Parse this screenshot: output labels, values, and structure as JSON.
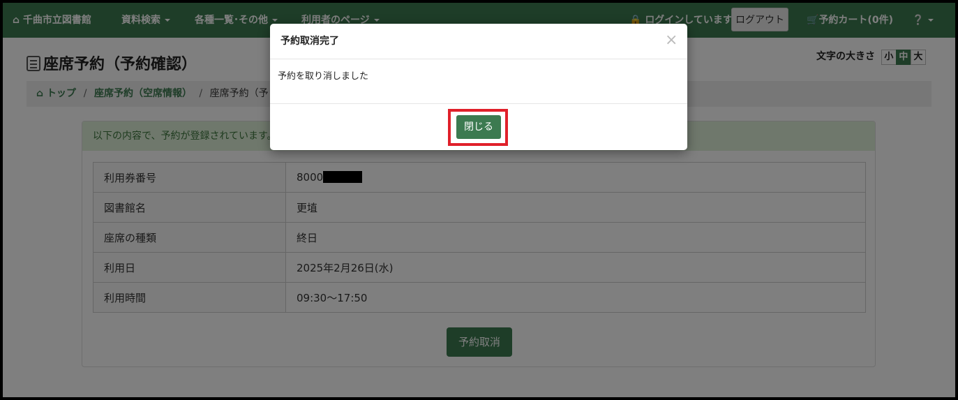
{
  "navbar": {
    "brand": "千曲市立図書館",
    "menu_search": "資料検索",
    "menu_lists": "各種一覧･その他",
    "menu_user": "利用者のページ",
    "login_status": "ログインしています",
    "logout": "ログアウト",
    "cart": "予約カート(0件)",
    "help_icon": "question-circle-icon"
  },
  "page": {
    "title": "座席予約（予約確認）",
    "font_size_label": "文字の大きさ",
    "font_sizes": [
      "小",
      "中",
      "大"
    ],
    "font_size_selected": "中"
  },
  "breadcrumb": {
    "home": "トップ",
    "sep1": "/",
    "item1": "座席予約（空席情報）",
    "sep2": "/",
    "item2": "座席予約（予"
  },
  "alert": "以下の内容で、予約が登録されています。取",
  "details": [
    {
      "label": "利用券番号",
      "value": "8000"
    },
    {
      "label": "図書館名",
      "value": "更埴"
    },
    {
      "label": "座席の種類",
      "value": "終日"
    },
    {
      "label": "利用日",
      "value": "2025年2月26日(水)"
    },
    {
      "label": "利用時間",
      "value": "09:30〜17:50"
    }
  ],
  "cancel_button": "予約取消",
  "modal": {
    "title": "予約取消完了",
    "close_x": "×",
    "message": "予約を取り消しました",
    "close_button": "閉じる"
  },
  "colors": {
    "brand_green": "#3c7a50",
    "highlight_red": "#e0202a",
    "alert_bg": "#dff0d8"
  }
}
